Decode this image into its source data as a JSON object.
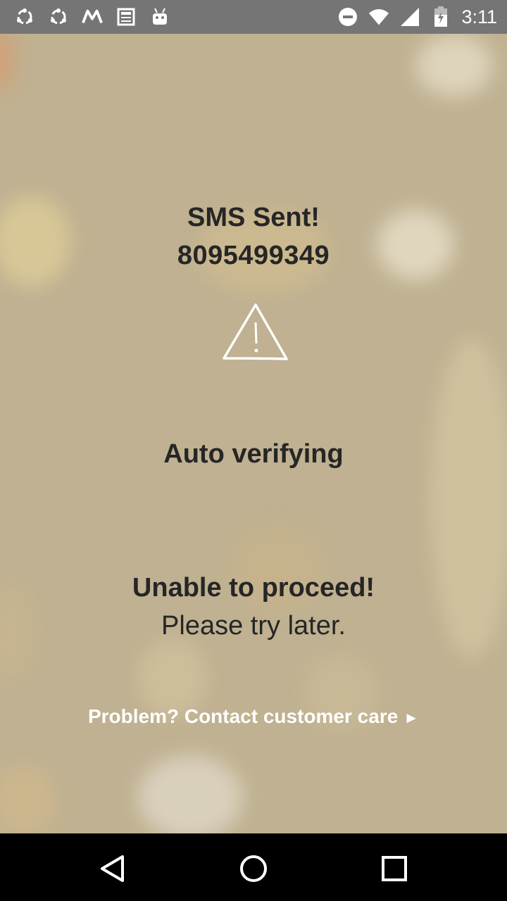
{
  "status_bar": {
    "time": "3:11",
    "left_icons": [
      "share-icon",
      "share-icon",
      "moto-icon",
      "news-icon",
      "android-icon"
    ],
    "right_icons": [
      "do-not-disturb-icon",
      "wifi-icon",
      "cell-signal-icon",
      "battery-charging-icon"
    ]
  },
  "main": {
    "title": "SMS Sent!",
    "phone_number": "8095499349",
    "status_icon": "warning-icon",
    "auto_verify_text": "Auto verifying",
    "error_title": "Unable to proceed!",
    "error_message": "Please try later.",
    "contact_link": "Problem? Contact customer care",
    "contact_arrow": "►"
  },
  "nav_bar": {
    "buttons": [
      "back-icon",
      "home-icon",
      "recents-icon"
    ]
  },
  "colors": {
    "background": "#bfb191",
    "status_bar": "#757575",
    "text": "#262626",
    "link": "#ffffff"
  }
}
